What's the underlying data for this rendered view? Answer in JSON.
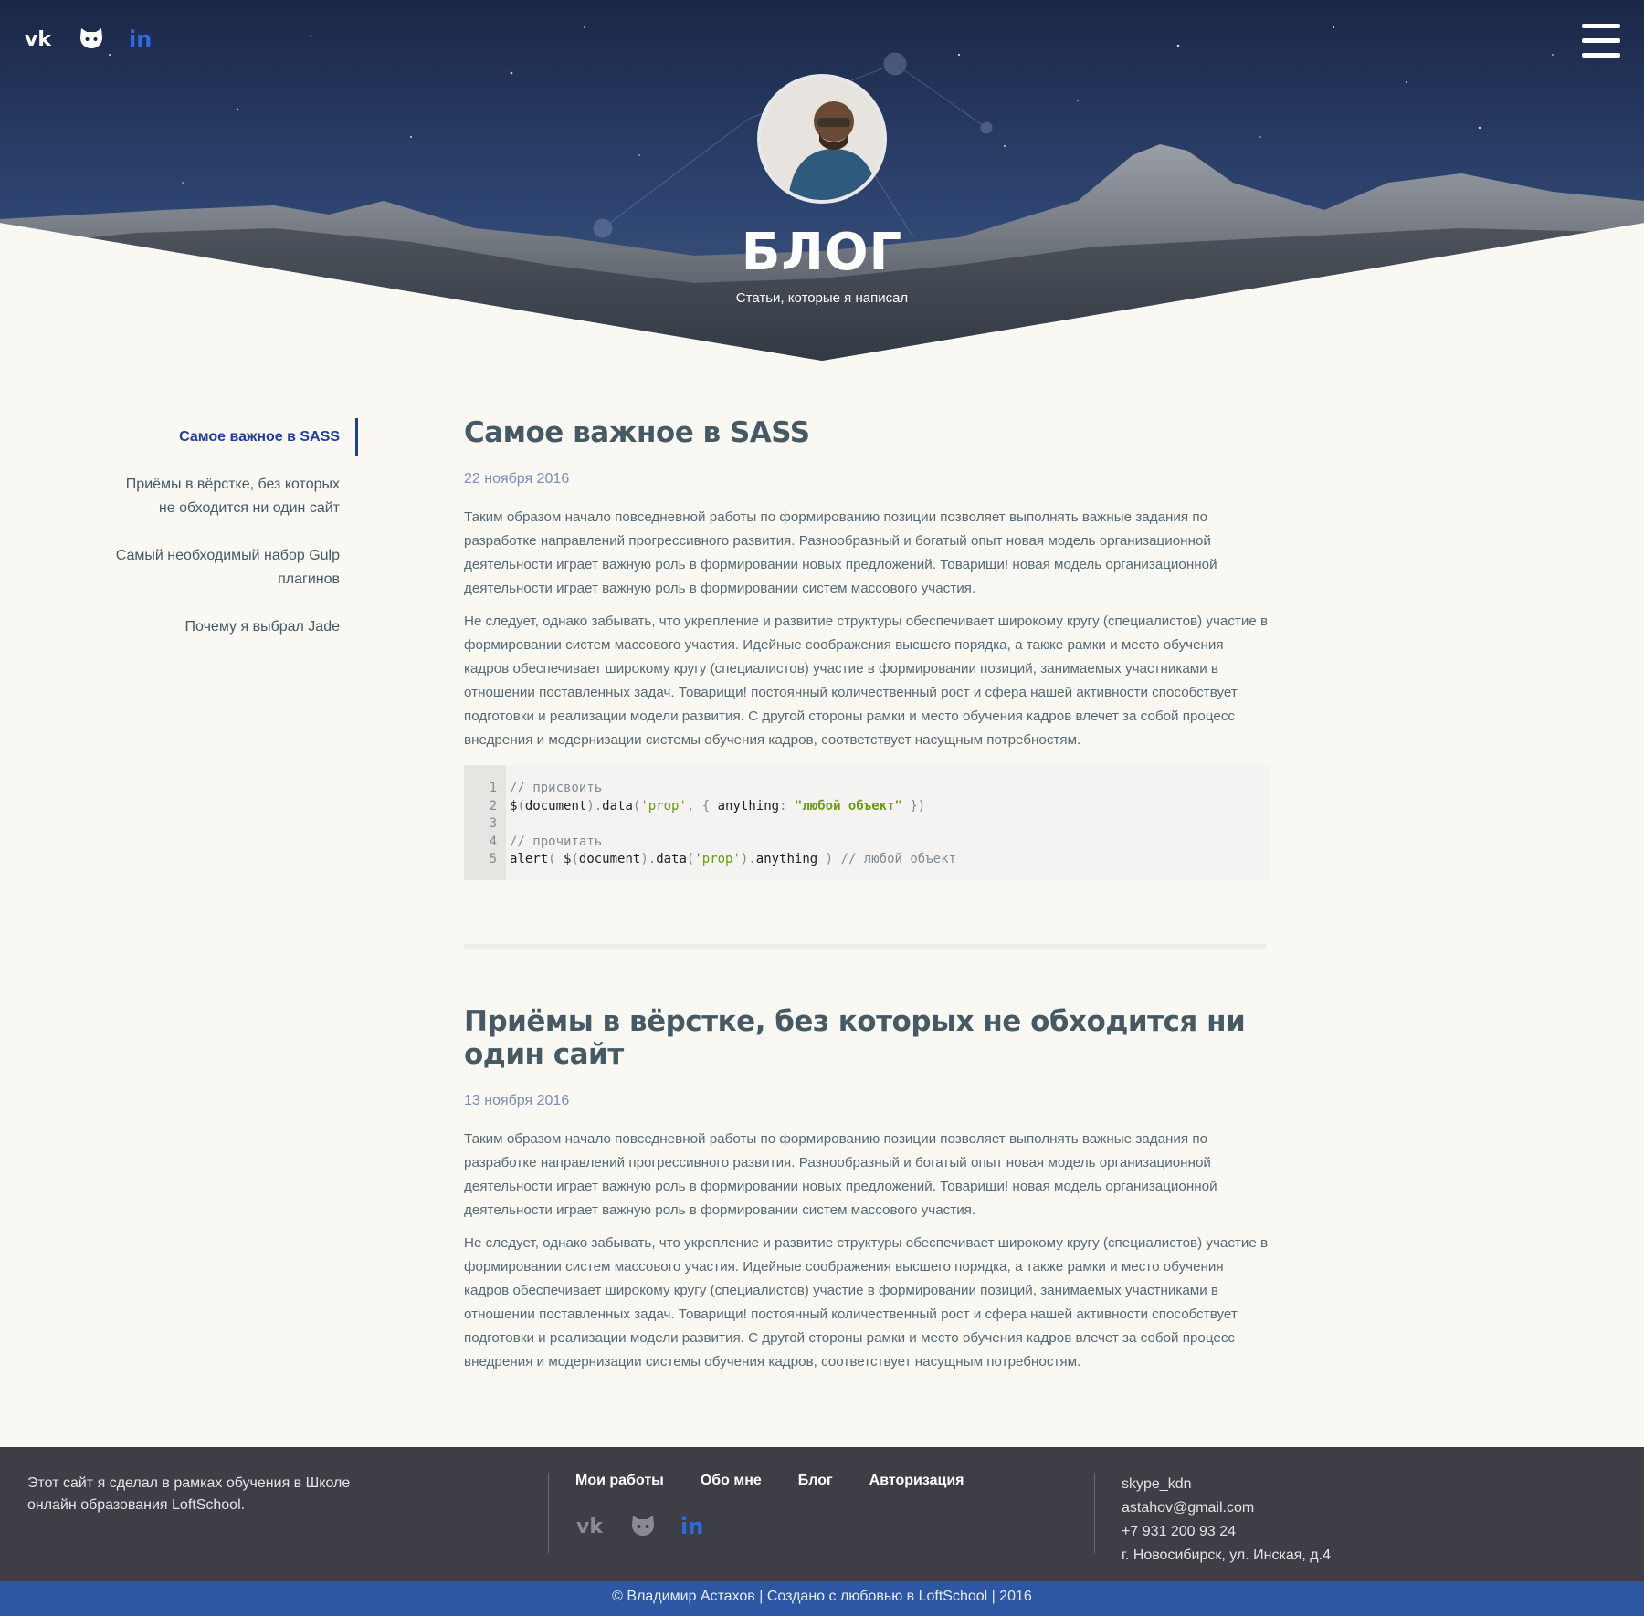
{
  "colors": {
    "accent": "#1e3f9a",
    "footer_bg": "#3e3f46",
    "copyright_bg": "#2d56a4",
    "page_bg": "#faf8f2"
  },
  "header": {
    "socials": [
      {
        "icon": "vk-icon"
      },
      {
        "icon": "github-icon"
      },
      {
        "icon": "linkedin-icon"
      }
    ],
    "menu_icon": "hamburger-icon",
    "title": "БЛОГ",
    "subtitle": "Статьи, которые я написал"
  },
  "sidebar": {
    "items": [
      {
        "label": "Самое важное в SASS",
        "active": true
      },
      {
        "label": "Приёмы в вёрстке, без которых не обходится ни один сайт",
        "active": false
      },
      {
        "label": "Самый необходимый набор Gulp плагинов",
        "active": false
      },
      {
        "label": "Почему я выбрал Jade",
        "active": false
      }
    ]
  },
  "articles": [
    {
      "title": "Самое важное в SASS",
      "date": "22 ноября 2016",
      "paragraphs": [
        "Таким образом начало повседневной работы по формированию позиции позволяет выполнять важные задания по разработке направлений прогрессивного развития. Разнообразный и богатый опыт новая модель организационной деятельности играет важную роль в формировании новых предложений. Товарищи! новая модель организационной деятельности играет важную роль в формировании систем массового участия.",
        "Не следует, однако забывать, что укрепление и развитие структуры обеспечивает широкому кругу (специалистов) участие в формировании систем массового участия. Идейные соображения высшего порядка, а также рамки и место обучения кадров обеспечивает широкому кругу (специалистов) участие в формировании позиций, занимаемых участниками в отношении поставленных задач. Товарищи! постоянный количественный рост и сфера нашей активности способствует подготовки и реализации модели развития. С другой стороны рамки и место обучения кадров влечет за собой процесс внедрения и модернизации системы обучения кадров, соответствует насущным потребностям."
      ],
      "code": {
        "line_numbers": [
          "1",
          "2",
          "3",
          "4",
          "5"
        ],
        "comment1": "// присвоить",
        "line2_fn": "$",
        "line2_a": "document",
        "line2_b": "data",
        "line2_str1": "'prop'",
        "line2_key": "anything",
        "line2_str2": "\"любой объект\"",
        "comment2": "// прочитать",
        "line5_fn": "alert",
        "line5_a": "document",
        "line5_b": "data",
        "line5_str": "'prop'",
        "line5_key": "anything",
        "line5_comment": "// любой объект"
      }
    },
    {
      "title": "Приёмы в вёрстке, без которых не обходится ни один сайт",
      "date": "13 ноября 2016",
      "paragraphs": [
        "Таким образом начало повседневной работы по формированию позиции позволяет выполнять важные задания по разработке направлений прогрессивного развития. Разнообразный и богатый опыт новая модель организационной деятельности играет важную роль в формировании новых предложений. Товарищи! новая модель организационной деятельности играет важную роль в формировании систем массового участия.",
        "Не следует, однако забывать, что укрепление и развитие структуры обеспечивает широкому кругу (специалистов) участие в формировании систем массового участия. Идейные соображения высшего порядка, а также рамки и место обучения кадров обеспечивает широкому кругу (специалистов) участие в формировании позиций, занимаемых участниками в отношении поставленных задач. Товарищи! постоянный количественный рост и сфера нашей активности способствует подготовки и реализации модели развития. С другой стороны рамки и место обучения кадров влечет за собой процесс внедрения и модернизации системы обучения кадров, соответствует насущным потребностям."
      ]
    }
  ],
  "footer": {
    "about": "Этот сайт я сделал в рамках обучения в Школе онлайн образования LoftSchool.",
    "nav": [
      "Мои работы",
      "Обо мне",
      "Блог",
      "Авторизация"
    ],
    "contacts": [
      "skype_kdn",
      "astahov@gmail.com",
      "+7 931 200 93 24",
      "г. Новосибирск, ул. Инская, д.4"
    ],
    "copyright": "© Владимир Астахов | Создано с любовью в LoftSchool | 2016"
  }
}
